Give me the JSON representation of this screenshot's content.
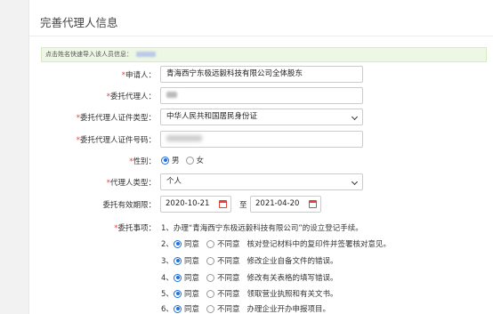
{
  "page_title": "完善代理人信息",
  "hint": "点击姓名快速导入该人员信息：",
  "fields": {
    "applicant": {
      "label": "申请人：",
      "value": "青海西宁东极远毅科技有限公司全体股东"
    },
    "agent": {
      "label": "委托代理人："
    },
    "id_type": {
      "label": "委托代理人证件类型：",
      "value": "中华人民共和国居民身份证"
    },
    "id_number": {
      "label": "委托代理人证件号码："
    },
    "gender": {
      "label": "性别：",
      "options": [
        "男",
        "女"
      ],
      "selected": "男"
    },
    "agent_type": {
      "label": "代理人类型：",
      "value": "个人"
    },
    "validity": {
      "label": "委托有效期限：",
      "start": "2020-10-21",
      "sep": "至",
      "end": "2021-04-20"
    },
    "matters": {
      "label": "委托事项：",
      "item1": "1、办理“青海西宁东极远毅科技有限公司”的设立登记手续。",
      "agree": "同意",
      "disagree": "不同意",
      "items": [
        {
          "num": "2、",
          "text": "核对登记材料中的复印件并签署核对意见。"
        },
        {
          "num": "3、",
          "text": "修改企业自备文件的错误。"
        },
        {
          "num": "4、",
          "text": "修改有关表格的填写错误。"
        },
        {
          "num": "5、",
          "text": "领取营业执照和有关文书。"
        },
        {
          "num": "6、",
          "text": "办理企业开办申报项目。"
        }
      ]
    }
  }
}
